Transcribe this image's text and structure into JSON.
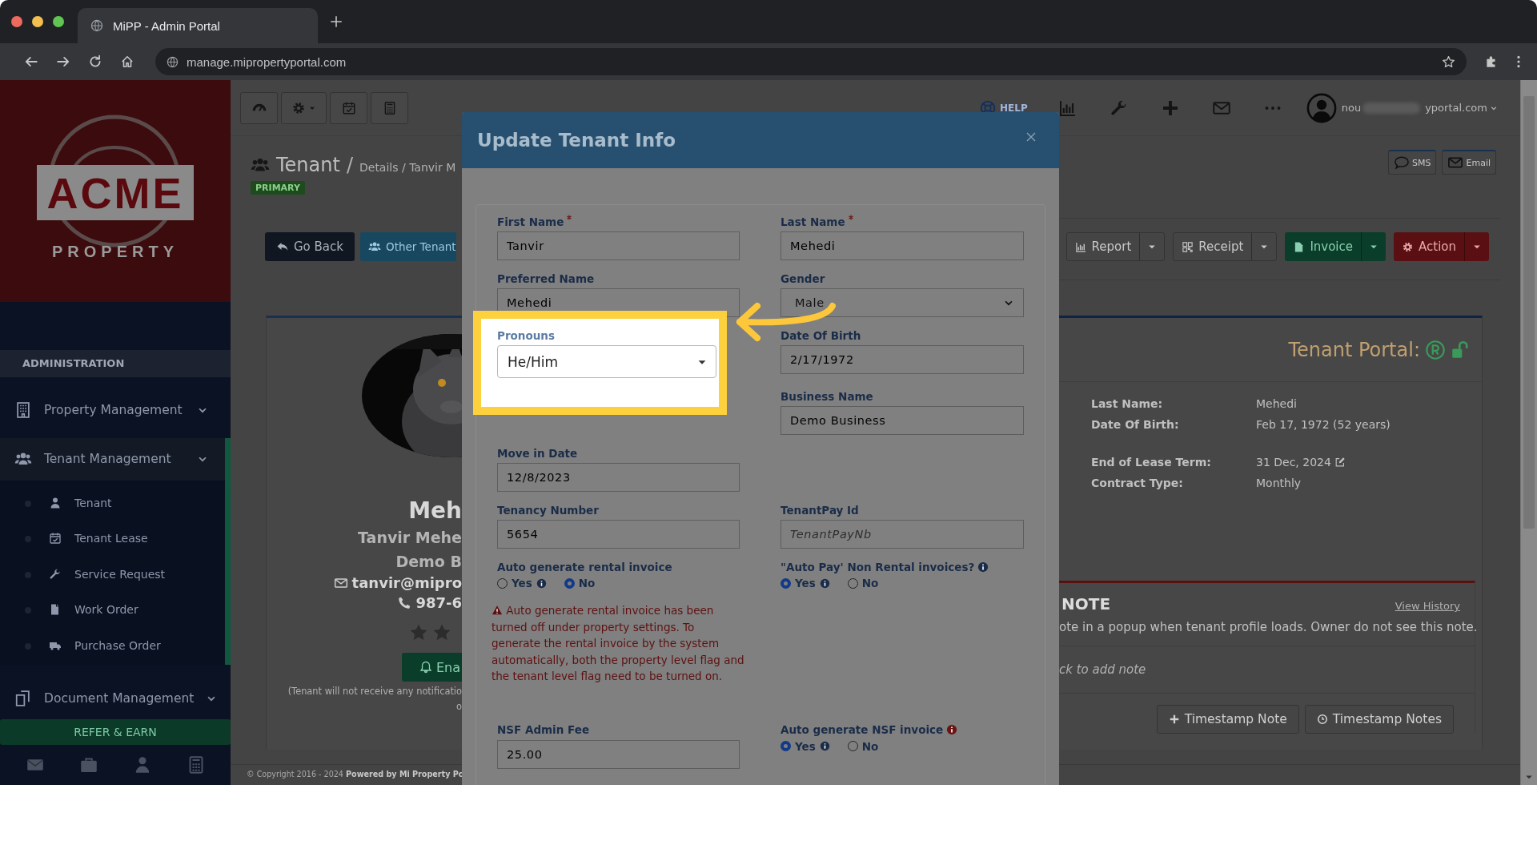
{
  "browser": {
    "tab_title": "MiPP - Admin Portal",
    "url": "manage.mipropertyportal.com"
  },
  "sidebar": {
    "logo_word": "ACME",
    "logo_subword": "PROPERTY",
    "section_title": "ADMINISTRATION",
    "menu": [
      {
        "label": "Property Management",
        "expanded": false
      },
      {
        "label": "Tenant Management",
        "expanded": true,
        "children": [
          {
            "label": "Tenant"
          },
          {
            "label": "Tenant Lease"
          },
          {
            "label": "Service Request"
          },
          {
            "label": "Work Order"
          },
          {
            "label": "Purchase Order"
          }
        ]
      },
      {
        "label": "Document Management",
        "expanded": false
      }
    ],
    "refer_button": "REFER & EARN"
  },
  "header": {
    "help": "HELP",
    "user_email_start": "nou",
    "user_email_end": "yportal.com"
  },
  "page": {
    "title": "Tenant",
    "separator": "/",
    "breadcrumb": "Details / Tanvir M",
    "badge": "PRIMARY",
    "message_buttons": [
      "SMS",
      "Email"
    ],
    "nav_buttons": [
      {
        "label": "Go Back",
        "kind": "dark"
      },
      {
        "label": "Other Tenant",
        "kind": "info"
      }
    ],
    "action_buttons": [
      {
        "label": "Report",
        "kind": "light"
      },
      {
        "label": "Receipt",
        "kind": "light"
      },
      {
        "label": "Invoice",
        "kind": "success"
      },
      {
        "label": "Action",
        "kind": "danger"
      }
    ]
  },
  "profile": {
    "name": "Meh",
    "full_name": "Tanvir Mehe",
    "company": "Demo B",
    "email": "tanvir@mipro",
    "phone": "987-6",
    "enable_button": "Ena",
    "notice": [
      "(Tenant will not receive any notificatio",
      "o"
    ]
  },
  "portal": {
    "title": "Tenant Portal:",
    "details": [
      {
        "label": "Last Name:",
        "value": "Mehedi",
        "editable": false
      },
      {
        "label": "Date Of Birth:",
        "value": "Feb 17, 1972 (52 years)",
        "editable": false
      },
      {
        "label": "End of Lease Term:",
        "value": "31 Dec, 2024",
        "editable": true
      },
      {
        "label": "Contract Type:",
        "value": "Monthly",
        "editable": false
      }
    ]
  },
  "note": {
    "title": "NOTE",
    "history_link": "View History",
    "description": "ote in a popup when tenant profile loads. Owner do not see this note.",
    "placeholder": "ck to add note",
    "buttons": [
      "Timestamp Note",
      "Timestamp Notes"
    ]
  },
  "footer": "© Copyright 2016 - 2024 **Powered by Mi Property Po**",
  "modal": {
    "title": "Update Tenant Info",
    "fields": [
      {
        "kind": "text",
        "label": "First Name",
        "required": true,
        "info": false,
        "value": "Tanvir",
        "highlighted": false
      },
      {
        "kind": "text",
        "label": "Last Name",
        "required": true,
        "info": false,
        "value": "Mehedi",
        "highlighted": false
      },
      {
        "kind": "text",
        "label": "Preferred Name",
        "required": false,
        "info": false,
        "value": "Mehedi",
        "highlighted": false
      },
      {
        "kind": "select",
        "label": "Gender",
        "required": false,
        "info": false,
        "value": "Male",
        "highlighted": false
      },
      {
        "kind": "dropdown",
        "label": "Pronouns",
        "required": false,
        "info": false,
        "value": "He/Him",
        "highlighted": true
      },
      {
        "kind": "text",
        "label": "Date Of Birth",
        "required": false,
        "info": false,
        "value": "2/17/1972",
        "highlighted": false
      },
      {
        "kind": "text",
        "label": "Business Name",
        "required": false,
        "info": false,
        "value": "Demo Business",
        "highlighted": false
      },
      {
        "kind": "text",
        "label": "Move in Date",
        "required": false,
        "info": false,
        "value": "12/8/2023",
        "highlighted": false
      },
      {
        "kind": "text",
        "label": "Tenancy Number",
        "required": false,
        "info": false,
        "value": "5654",
        "highlighted": false
      },
      {
        "kind": "text",
        "label": "TenantPay Id",
        "required": false,
        "info": false,
        "placeholder": "TenantPayNb",
        "highlighted": false
      },
      {
        "kind": "radio",
        "label": "Auto generate rental invoice",
        "required": false,
        "info": false,
        "highlighted": false,
        "options": [
          {
            "label": "Yes",
            "selected": false,
            "info": true
          },
          {
            "label": "No",
            "selected": true,
            "info": false
          }
        ],
        "warning": "Auto generate rental invoice has been turned off under property settings. To generate the rental invoice by the system automatically, both the property level flag and the tenant level flag need to be turned on."
      },
      {
        "kind": "radio",
        "label": "\"Auto Pay' Non Rental invoices?",
        "required": false,
        "info": true,
        "alert": false,
        "highlighted": false,
        "options": [
          {
            "label": "Yes",
            "selected": true,
            "info": true
          },
          {
            "label": "No",
            "selected": false,
            "info": false
          }
        ]
      },
      {
        "kind": "text",
        "label": "NSF Admin Fee",
        "required": false,
        "info": false,
        "value": "25.00",
        "highlighted": false
      },
      {
        "kind": "radio",
        "label": "Auto generate NSF invoice",
        "required": false,
        "info": true,
        "alert": true,
        "highlighted": false,
        "options": [
          {
            "label": "Yes",
            "selected": true,
            "info": true
          },
          {
            "label": "No",
            "selected": false,
            "info": false
          }
        ]
      }
    ]
  }
}
